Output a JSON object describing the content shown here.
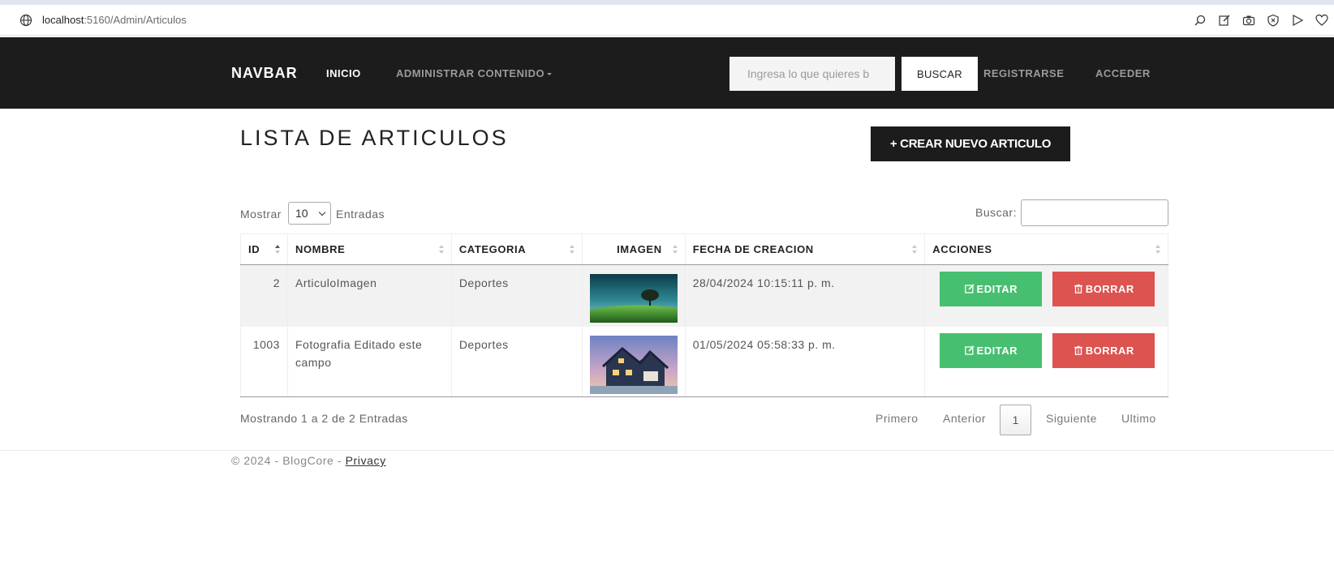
{
  "browser": {
    "url_host": "localhost",
    "url_rest": ":5160/Admin/Articulos"
  },
  "navbar": {
    "brand": "NAVBAR",
    "inicio": "INICIO",
    "admin": "ADMINISTRAR CONTENIDO",
    "search_placeholder": "Ingresa lo que quieres b",
    "search_button": "BUSCAR",
    "register": "REGISTRARSE",
    "login": "ACCEDER"
  },
  "page": {
    "title": "LISTA DE ARTICULOS",
    "create_button": "+ CREAR NUEVO ARTICULO"
  },
  "table_controls": {
    "show_label": "Mostrar",
    "page_size": "10",
    "entries_label": "Entradas",
    "filter_label": "Buscar:"
  },
  "table": {
    "columns": [
      "ID",
      "NOMBRE",
      "CATEGORIA",
      "IMAGEN",
      "FECHA DE CREACION",
      "ACCIONES"
    ],
    "rows": [
      {
        "id": "2",
        "nombre": "ArticuloImagen",
        "categoria": "Deportes",
        "imagen": "landscape-tree-thumbnail",
        "fecha": "28/04/2024 10:15:11 p. m."
      },
      {
        "id": "1003",
        "nombre": "Fotografia Editado este campo",
        "categoria": "Deportes",
        "imagen": "house-thumbnail",
        "fecha": "01/05/2024 05:58:33 p. m."
      }
    ],
    "edit_label": "EDITAR",
    "delete_label": "BORRAR"
  },
  "pagination": {
    "info": "Mostrando 1 a 2 de 2 Entradas",
    "first": "Primero",
    "previous": "Anterior",
    "current": "1",
    "next": "Siguiente",
    "last": "Ultimo"
  },
  "footer": {
    "text": "© 2024 - BlogCore - ",
    "privacy": "Privacy"
  },
  "colors": {
    "navbar_bg": "#1c1c1c",
    "edit_green": "#47bf70",
    "delete_red": "#dc534f"
  }
}
